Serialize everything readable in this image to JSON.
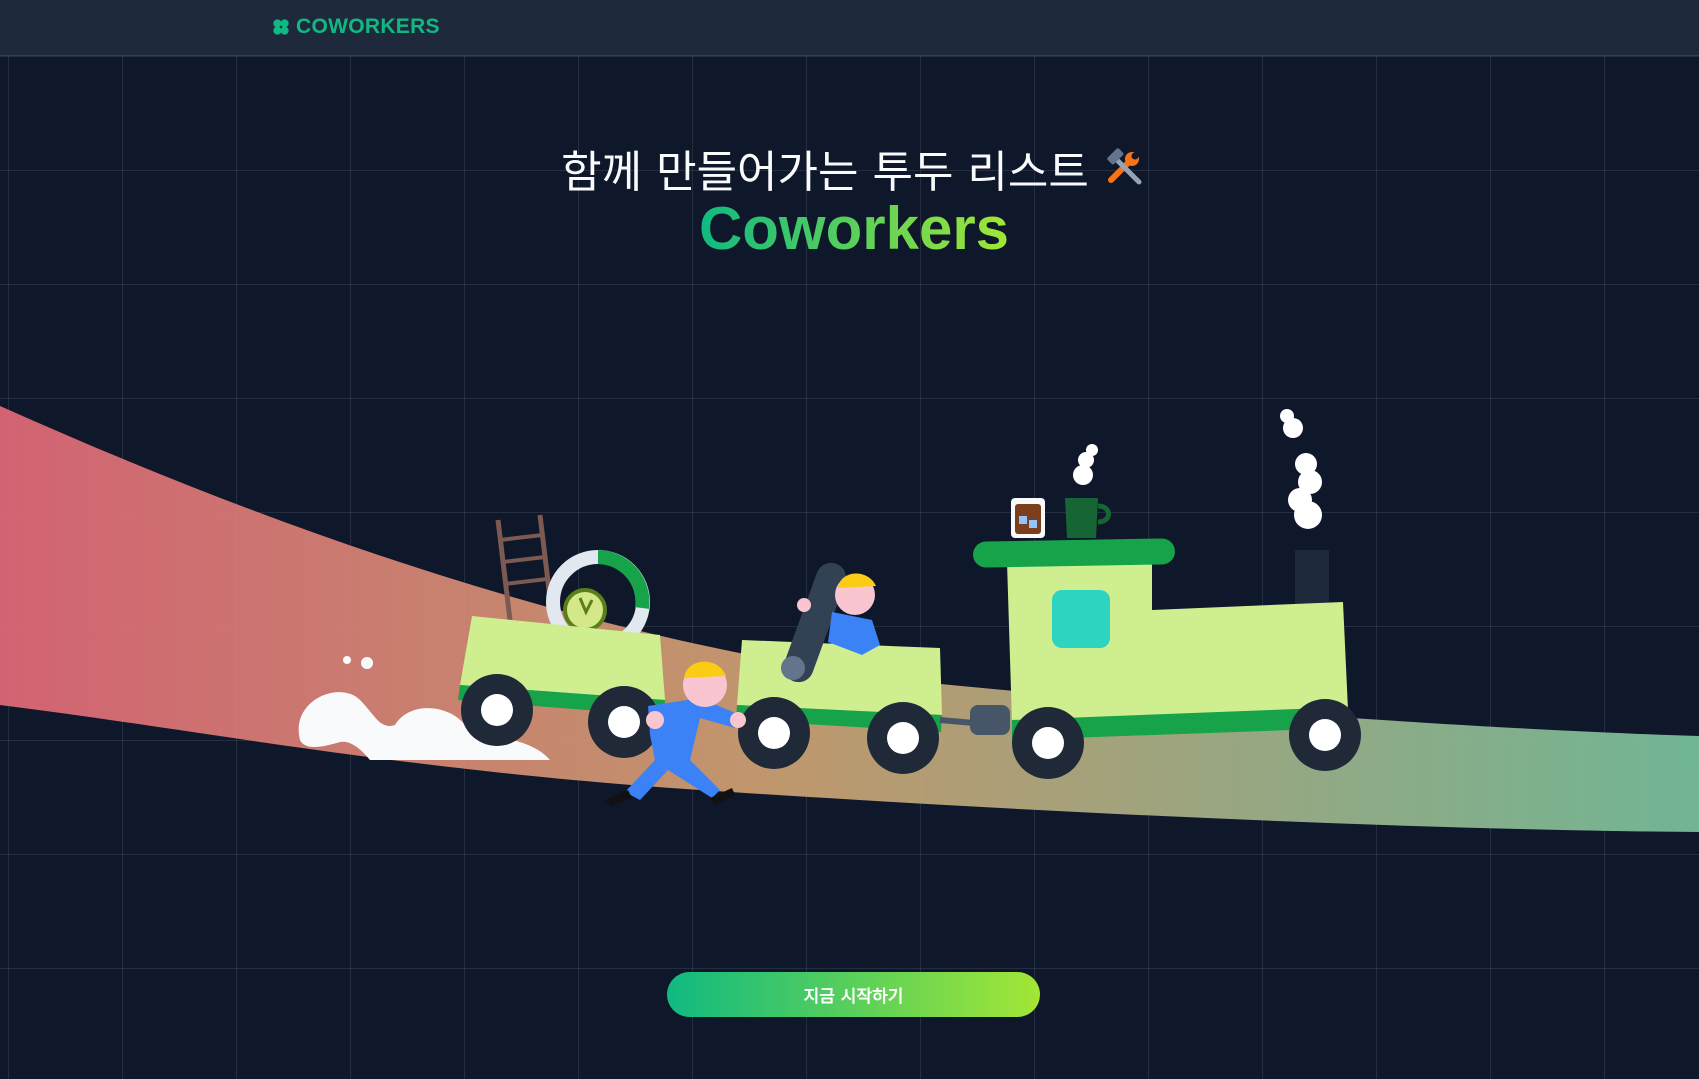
{
  "header": {
    "brand": "COWORKERS",
    "icon": "clover-logo-icon"
  },
  "hero": {
    "tagline": "함께 만들어가는 투두 리스트",
    "tagline_icon": "hammer-wrench-icon",
    "title": "Coworkers"
  },
  "cta": {
    "label": "지금 시작하기"
  },
  "colors": {
    "background": "#0f172a",
    "topbar": "#1e293b",
    "brand": "#10b981",
    "accent_end": "#a3e635"
  }
}
